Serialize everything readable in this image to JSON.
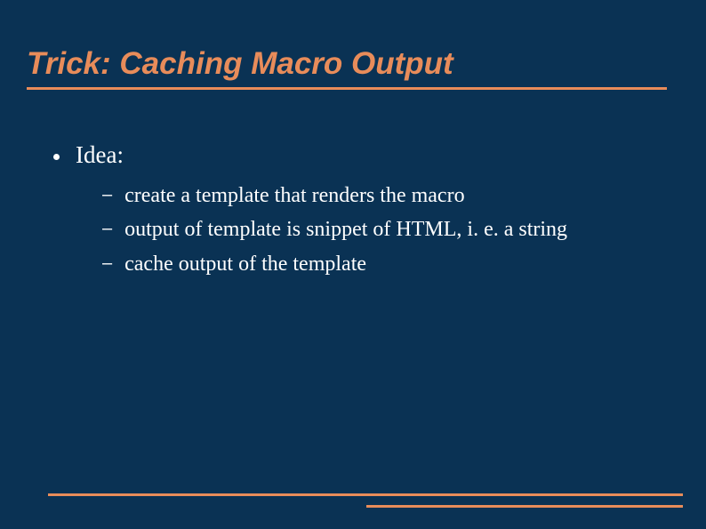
{
  "title": "Trick: Caching Macro Output",
  "bullet": {
    "label": "Idea:",
    "subitems": [
      "create a template that renders the macro",
      "output of template is snippet of HTML, i. e. a string",
      "cache output of the template"
    ]
  },
  "colors": {
    "accent": "#e88c5a",
    "background": "#0a3254",
    "text": "#ffffff"
  }
}
